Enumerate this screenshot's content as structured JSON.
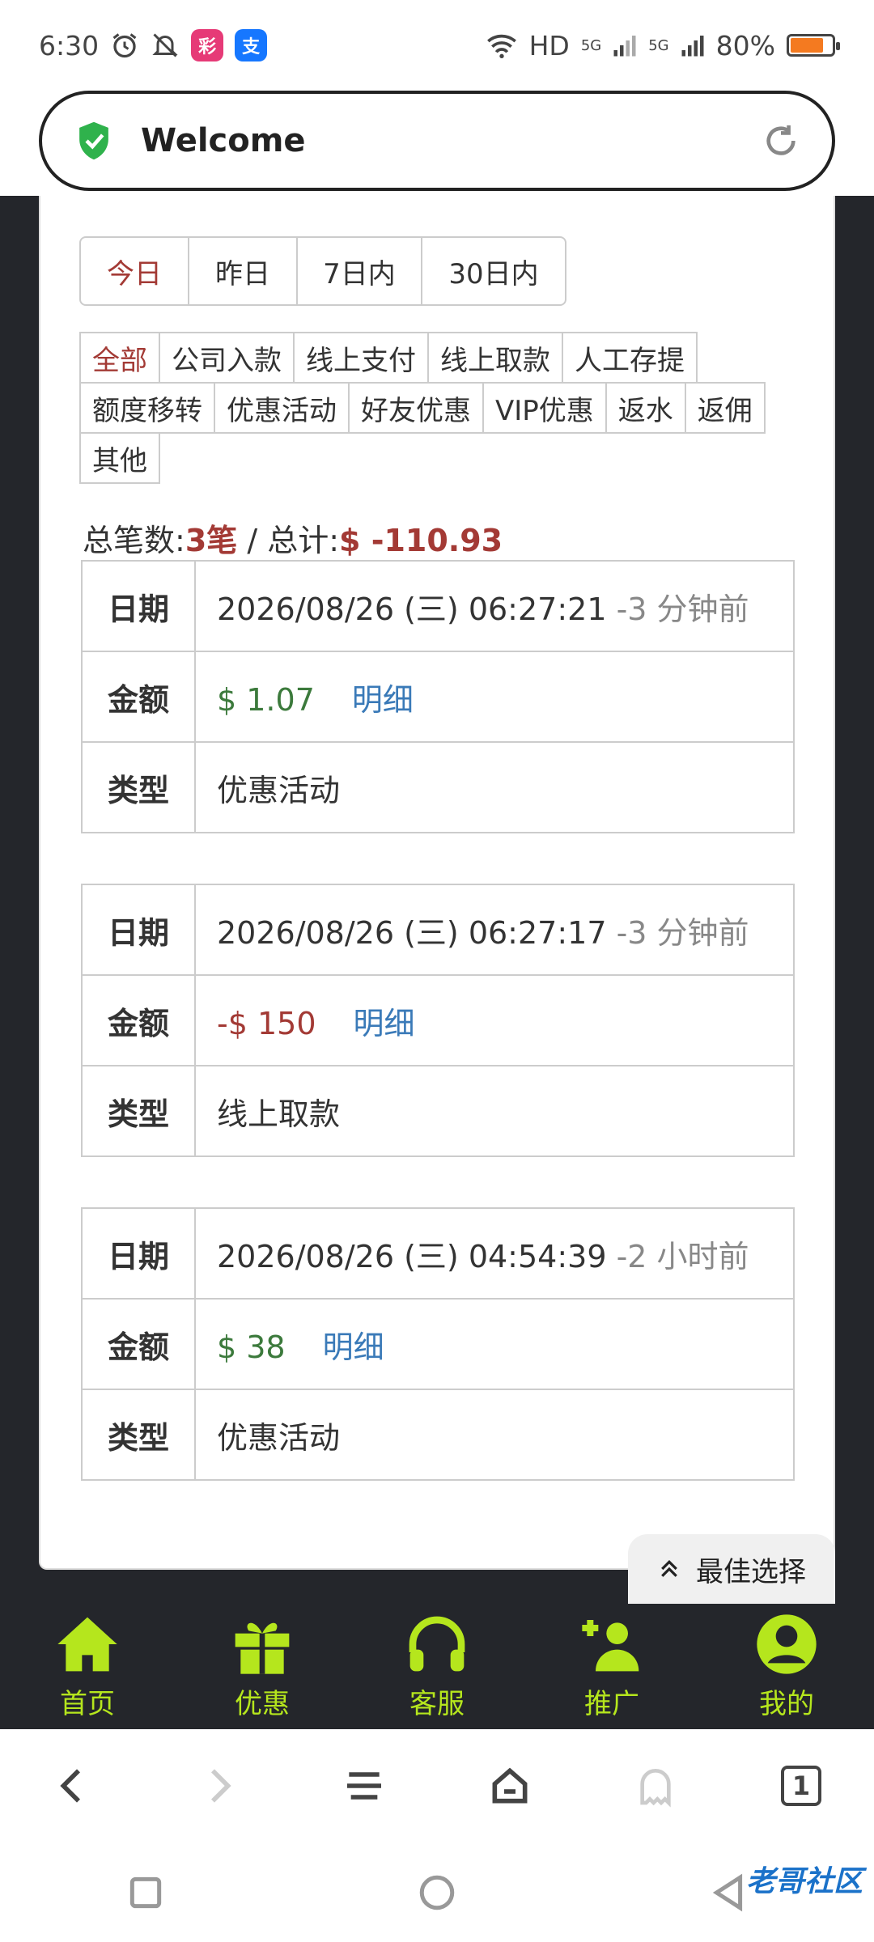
{
  "status_bar": {
    "time": "6:30",
    "network": "HD",
    "signal1": "5G",
    "signal2": "5G",
    "battery": "80%",
    "battery_level": 0.8,
    "app_icon_pink": "lottery-app-icon",
    "app_icon_blue": "alipay-icon"
  },
  "url_bar": {
    "title": "Welcome"
  },
  "date_tabs": [
    "今日",
    "昨日",
    "7日内",
    "30日内"
  ],
  "type_tags": [
    "全部",
    "公司入款",
    "线上支付",
    "线上取款",
    "人工存提",
    "额度移转",
    "优惠活动",
    "好友优惠",
    "VIP优惠",
    "返水",
    "返佣",
    "其他"
  ],
  "summary": {
    "count_label": "总笔数:",
    "count_value": "3笔",
    "sep": " / ",
    "total_label": "总计:",
    "total_value": "$ -110.93"
  },
  "labels": {
    "date": "日期",
    "amount": "金额",
    "type": "类型",
    "detail": "明细"
  },
  "records": [
    {
      "date": "2026/08/26 (三) 06:27:21",
      "ago": "-3 分钟前",
      "amount": "$ 1.07",
      "type": "优惠活动"
    },
    {
      "date": "2026/08/26 (三) 06:27:17",
      "ago": "-3 分钟前",
      "amount": "-$ 150",
      "type": "线上取款"
    },
    {
      "date": "2026/08/26 (三) 04:54:39",
      "ago": "-2 小时前",
      "amount": "$ 38",
      "type": "优惠活动"
    }
  ],
  "best_choice": "最佳选择",
  "app_nav": [
    "首页",
    "优惠",
    "客服",
    "推广",
    "我的"
  ],
  "browser": {
    "tab_count": "1"
  },
  "watermark": "老哥社区",
  "colors": {
    "accent_red": "#a33a35",
    "nav_green": "#b5e61d",
    "positive": "#3c7a3c",
    "link": "#3a7ab8",
    "dark_bg": "#24262b"
  }
}
